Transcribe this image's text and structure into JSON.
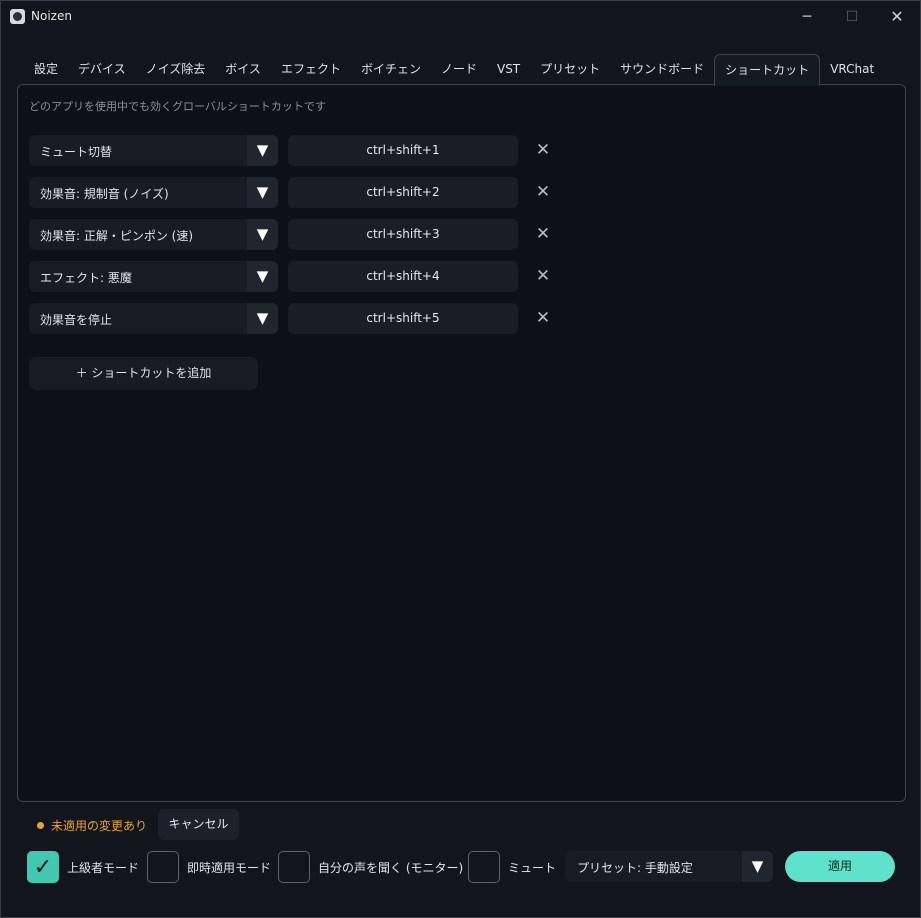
{
  "window": {
    "title": "Noizen",
    "minimize_glyph": "─",
    "maximize_glyph": "☐",
    "close_glyph": "✕"
  },
  "tabs": [
    {
      "label": "設定"
    },
    {
      "label": "デバイス"
    },
    {
      "label": "ノイズ除去"
    },
    {
      "label": "ボイス"
    },
    {
      "label": "エフェクト"
    },
    {
      "label": "ボイチェン"
    },
    {
      "label": "ノード"
    },
    {
      "label": "VST"
    },
    {
      "label": "プリセット"
    },
    {
      "label": "サウンドボード"
    },
    {
      "label": "ショートカット",
      "active": true
    },
    {
      "label": "VRChat"
    }
  ],
  "shortcuts": {
    "description": "どのアプリを使用中でも効くグローバルショートカットです",
    "rows": [
      {
        "action": "ミュート切替",
        "keys": "ctrl+shift+1"
      },
      {
        "action": "効果音: 規制音 (ノイズ)",
        "keys": "ctrl+shift+2"
      },
      {
        "action": "効果音: 正解・ピンポン (速)",
        "keys": "ctrl+shift+3"
      },
      {
        "action": "エフェクト: 悪魔",
        "keys": "ctrl+shift+4"
      },
      {
        "action": "効果音を停止",
        "keys": "ctrl+shift+5"
      }
    ],
    "remove_glyph": "✕",
    "dropdown_glyph": "▼",
    "add_label": "＋  ショートカットを追加"
  },
  "footer": {
    "pending_text": "未適用の変更あり",
    "cancel_label": "キャンセル",
    "checkboxes": [
      {
        "label": "上級者モード",
        "checked": true
      },
      {
        "label": "即時適用モード",
        "checked": false
      },
      {
        "label": "自分の声を聞く (モニター)",
        "checked": false
      },
      {
        "label": "ミュート",
        "checked": false
      }
    ],
    "check_glyph": "✓",
    "preset_label": "プリセット: 手動設定",
    "apply_label": "適用"
  },
  "colors": {
    "accent": "#5fe2cb",
    "checkbox_on": "#43c7b1",
    "warning": "#e8a23a",
    "background": "#12151b"
  }
}
